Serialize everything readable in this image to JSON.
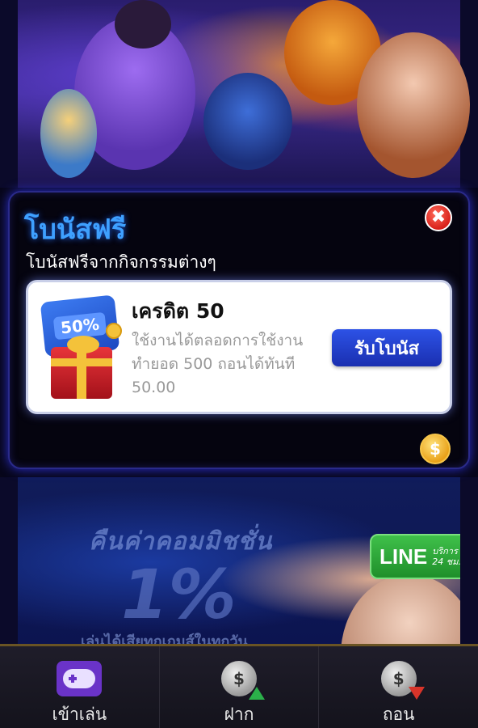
{
  "modal": {
    "title": "โบนัสฟรี",
    "subtitle": "โบนัสฟรีจากกิจกรรมต่างๆ",
    "close_symbol": "✖",
    "bonus": {
      "name": "เครดิต 50",
      "description": "ใช้งานได้ตลอดการใช้งาน ทำยอด 500 ถอนได้ทันที 50.00",
      "ticket_percent": "50%",
      "claim_label": "รับโบนัส"
    },
    "coin_symbol": "$"
  },
  "promo_banner": {
    "commission_text": "คืนค่าคอมมิชชั่น",
    "commission_percent": "1%",
    "commission_sub": "เล่นได้เสียทุกเกมส์ในทุกวัน",
    "line_logo": "LINE",
    "line_service": "บริการ",
    "line_hours": "24 ชม."
  },
  "bottom_nav": {
    "items": [
      {
        "label": "เข้าเล่น",
        "icon": "gamepad-icon",
        "active": true
      },
      {
        "label": "ฝาก",
        "icon": "deposit-coin-icon",
        "active": false
      },
      {
        "label": "ถอน",
        "icon": "withdraw-coin-icon",
        "active": false
      }
    ],
    "coin_symbol": "$"
  },
  "colors": {
    "title_blue": "#3ea0ff",
    "claim_button": "#2d52e6",
    "nav_active": "#6a33c8",
    "close_red": "#d8211a"
  }
}
